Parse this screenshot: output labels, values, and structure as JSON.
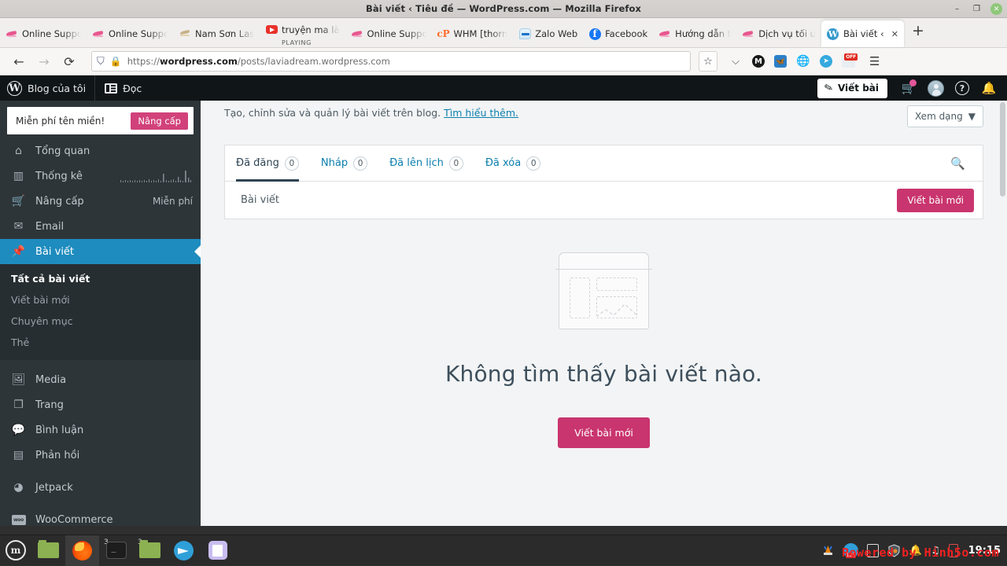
{
  "window": {
    "title": "Bài viết ‹ Tiêu đề — WordPress.com — Mozilla Firefox",
    "minimize": "–",
    "maximize": "❐",
    "close": "✕"
  },
  "browser": {
    "tabs": [
      {
        "label": "Online Support",
        "icon": "pink-bird-icon",
        "active": false
      },
      {
        "label": "Online Support",
        "icon": "pink-bird-icon",
        "active": false
      },
      {
        "label": "Nam Sơn Last",
        "icon": "tan-bird-icon",
        "active": false
      },
      {
        "label": "truyện ma là",
        "icon": "youtube-icon",
        "active": false,
        "status": "PLAYING"
      },
      {
        "label": "Online Support",
        "icon": "pink-bird-icon",
        "active": false
      },
      {
        "label": "WHM [thorn",
        "icon": "cpanel-icon",
        "active": false
      },
      {
        "label": "Zalo Web",
        "icon": "zalo-icon",
        "active": false
      },
      {
        "label": "Facebook",
        "icon": "facebook-icon",
        "active": false
      },
      {
        "label": "Hướng dẫn t",
        "icon": "pink-bird-icon",
        "active": false
      },
      {
        "label": "Dịch vụ tối ư",
        "icon": "pink-bird-icon",
        "active": false
      },
      {
        "label": "Bài viết ‹ T",
        "icon": "wordpress-icon",
        "active": true
      }
    ],
    "new_tab_label": "+",
    "nav": {
      "back": "←",
      "forward": "→",
      "reload": "⟳",
      "url_prefix": "https://",
      "url_domain": "wordpress.com",
      "url_path": "/posts/laviadream.wordpress.com",
      "bookmark_star": "☆"
    },
    "extensions": [
      "pocket-icon",
      "metamask-icon",
      "bluesky-icon",
      "globe-icon",
      "telegram-icon",
      "office-icon",
      "menu-icon"
    ],
    "office_badge": "OFF"
  },
  "wpbar": {
    "my_blog": "Blog của tôi",
    "reader": "Đọc",
    "write_post": "Viết bài",
    "icons": [
      "cart-icon",
      "avatar-icon",
      "help-icon",
      "bell-icon"
    ]
  },
  "sidebar": {
    "domain_banner": {
      "text": "Miễn phí tên miền!",
      "button": "Nâng cấp"
    },
    "items": [
      {
        "label": "Tổng quan",
        "icon": "home-icon",
        "right": "",
        "active": false
      },
      {
        "label": "Thống kê",
        "icon": "stats-bars-icon",
        "right": "sparkline",
        "active": false
      },
      {
        "label": "Nâng cấp",
        "icon": "cart-icon",
        "right": "Miễn phí",
        "active": false
      },
      {
        "label": "Email",
        "icon": "envelope-icon",
        "right": "",
        "active": false
      },
      {
        "label": "Bài viết",
        "icon": "pin-icon",
        "right": "",
        "active": true
      },
      {
        "label": "Media",
        "icon": "media-icon",
        "right": "",
        "active": false
      },
      {
        "label": "Trang",
        "icon": "pages-icon",
        "right": "",
        "active": false
      },
      {
        "label": "Bình luận",
        "icon": "comment-icon",
        "right": "",
        "active": false
      },
      {
        "label": "Phản hồi",
        "icon": "feedback-icon",
        "right": "",
        "active": false
      },
      {
        "label": "Jetpack",
        "icon": "jetpack-icon",
        "right": "",
        "active": false
      },
      {
        "label": "WooCommerce",
        "icon": "woo-icon",
        "right": "",
        "active": false
      }
    ],
    "submenu": [
      {
        "label": "Tất cả bài viết",
        "current": true
      },
      {
        "label": "Viết bài mới",
        "current": false
      },
      {
        "label": "Chuyên mục",
        "current": false
      },
      {
        "label": "Thẻ",
        "current": false
      }
    ]
  },
  "main": {
    "description": "Tạo, chỉnh sửa và quản lý bài viết trên blog.",
    "description_link": "Tìm hiểu thêm.",
    "view_mode": "Xem dạng",
    "view_mode_caret": "▼",
    "post_tabs": [
      {
        "label": "Đã đăng",
        "count": "0",
        "selected": true
      },
      {
        "label": "Nháp",
        "count": "0",
        "selected": false
      },
      {
        "label": "Đã lên lịch",
        "count": "0",
        "selected": false
      },
      {
        "label": "Đã xóa",
        "count": "0",
        "selected": false
      }
    ],
    "search_icon": "search-icon",
    "list_title": "Bài viết",
    "new_post_button": "Viết bài mới",
    "empty_message": "Không tìm thấy bài viết nào.",
    "empty_button": "Viết bài mới"
  },
  "taskbar": {
    "start": "start-menu-icon",
    "items": [
      {
        "icon": "folder-icon",
        "badge": "",
        "selected": false
      },
      {
        "icon": "firefox-icon",
        "badge": "",
        "selected": true
      },
      {
        "icon": "terminal-icon",
        "badge": "3",
        "selected": false
      },
      {
        "icon": "folder-icon",
        "badge": "3",
        "selected": false
      },
      {
        "icon": "telegram-icon",
        "badge": "",
        "selected": false
      },
      {
        "icon": "notes-icon",
        "badge": "",
        "selected": false
      }
    ],
    "tray": [
      "vlc-icon",
      "download-manager-icon",
      "clipboard-icon",
      "shield-icon",
      "bell-icon",
      "music-icon",
      "battery-icon"
    ],
    "clock": "19:15",
    "watermark": "Powered by Hinh5o.com"
  },
  "colors": {
    "accent_pink": "#c9356e",
    "accent_blue": "#1e8cbe",
    "link_blue": "#0b7fad",
    "sidebar_bg": "#2e3539",
    "wpbar_bg": "#101517"
  }
}
